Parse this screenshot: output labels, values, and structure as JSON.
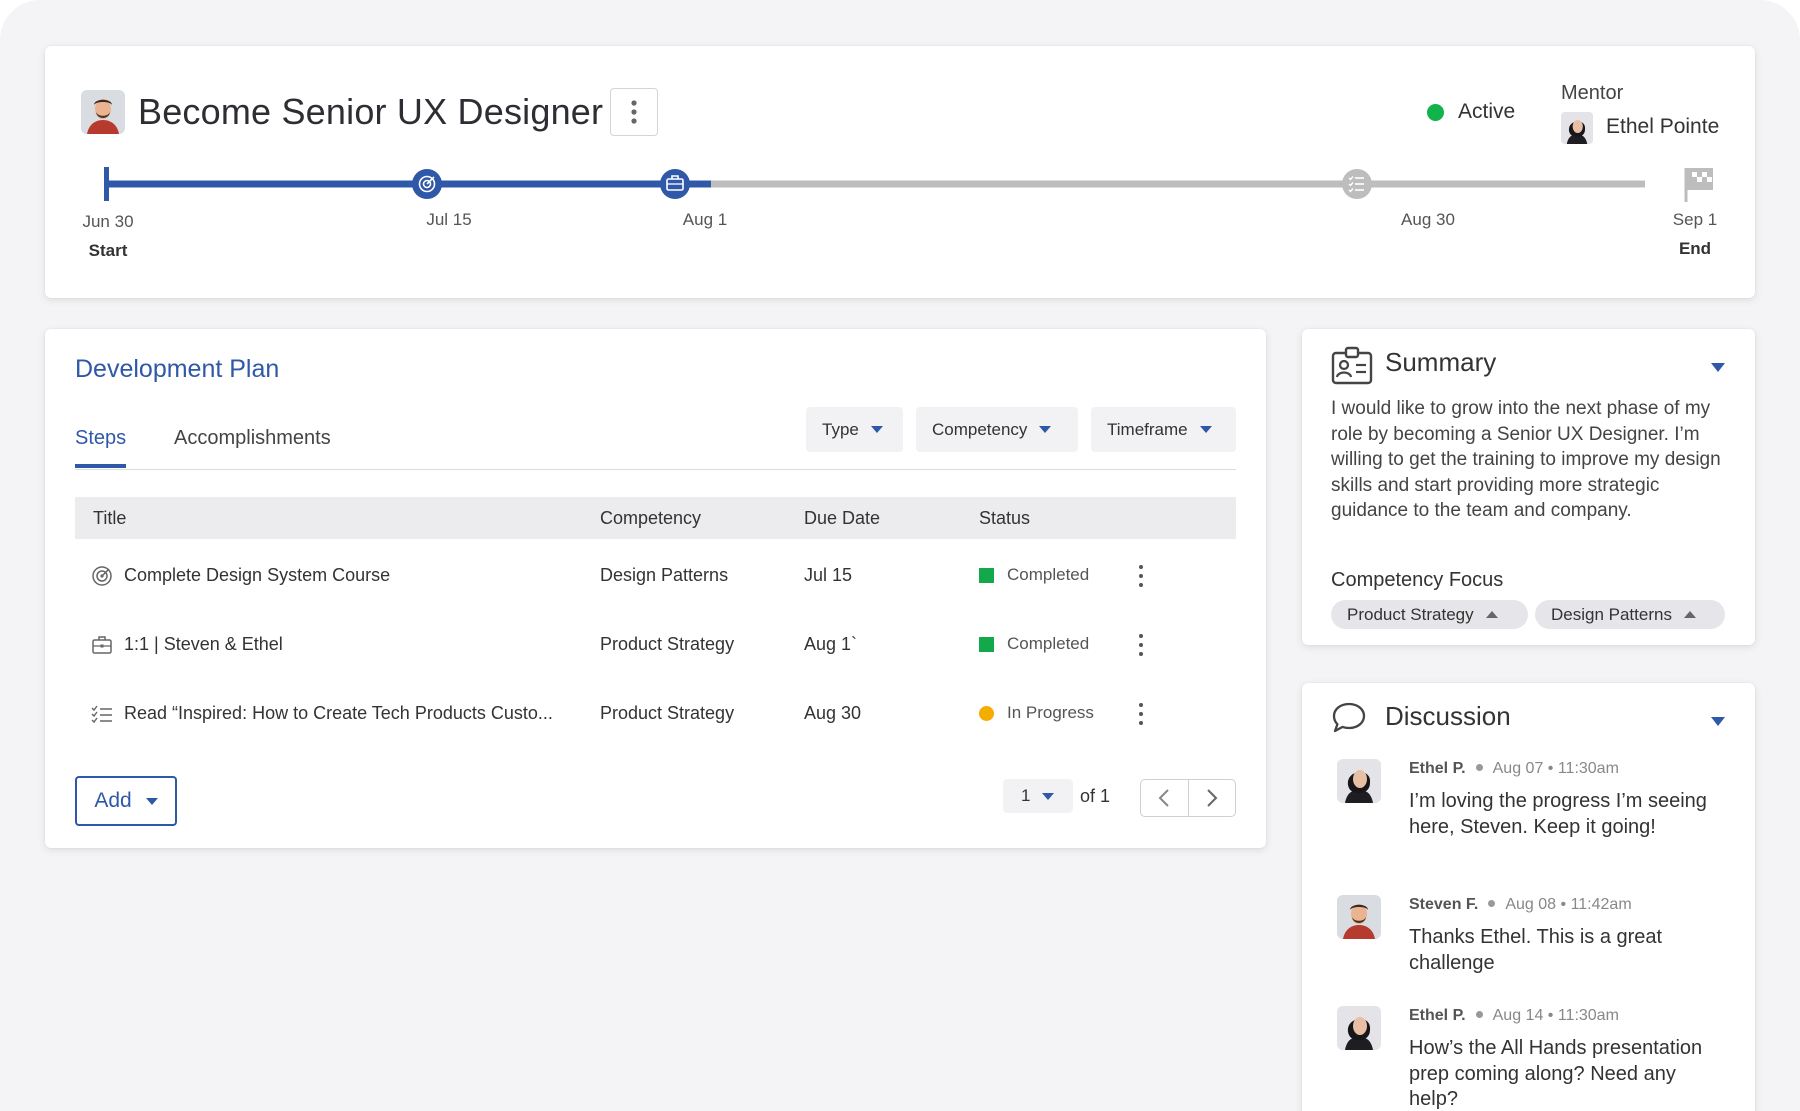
{
  "goal": {
    "title": "Become Senior UX Designer",
    "status": "Active",
    "status_color": "#12b34a",
    "mentor_label": "Mentor",
    "mentor_name": "Ethel Pointe"
  },
  "timeline": {
    "progress_color": "#2f58a8",
    "remaining_color": "#bdbdbd",
    "points": [
      {
        "date": "Jun 30",
        "sub": "Start",
        "icon": "start-marker"
      },
      {
        "date": "Jul 15",
        "sub": "",
        "icon": "target-icon"
      },
      {
        "date": "Aug 1",
        "sub": "",
        "icon": "briefcase-icon"
      },
      {
        "date": "Aug 30",
        "sub": "",
        "icon": "checklist-icon"
      },
      {
        "date": "Sep 1",
        "sub": "End",
        "icon": "flag-icon"
      }
    ]
  },
  "plan": {
    "title": "Development Plan",
    "tabs": [
      "Steps",
      "Accomplishments"
    ],
    "filters": [
      "Type",
      "Competency",
      "Timeframe"
    ],
    "columns": [
      "Title",
      "Competency",
      "Due Date",
      "Status"
    ],
    "rows": [
      {
        "icon": "target-icon",
        "title": "Complete Design System Course",
        "competency": "Design Patterns",
        "due": "Jul 15",
        "status": "Completed",
        "status_color": "#13a84a"
      },
      {
        "icon": "briefcase-icon",
        "title": "1:1 | Steven & Ethel",
        "competency": "Product Strategy",
        "due": "Aug 1`",
        "status": "Completed",
        "status_color": "#13a84a"
      },
      {
        "icon": "checklist-icon",
        "title": "Read “Inspired: How to Create Tech Products Custo...",
        "competency": "Product Strategy",
        "due": "Aug 30",
        "status": "In Progress",
        "status_color": "#f5ad00"
      }
    ],
    "add_label": "Add",
    "page_value": "1",
    "page_of": "of 1"
  },
  "summary": {
    "title": "Summary",
    "text": "I would like to grow into the next phase of my role by becoming a Senior UX Designer. I’m willing to get the training to improve my design skills and start providing more strategic guidance to the team and company.",
    "competency_label": "Competency Focus",
    "chips": [
      "Product Strategy",
      "Design Patterns"
    ]
  },
  "discussion": {
    "title": "Discussion",
    "messages": [
      {
        "author": "Ethel P.",
        "time": "Aug 07 • 11:30am",
        "body": "I’m loving the progress I’m seeing here, Steven. Keep it going!"
      },
      {
        "author": "Steven F.",
        "time": "Aug 08 • 11:42am",
        "body": "Thanks Ethel. This is a great challenge"
      },
      {
        "author": "Ethel P.",
        "time": "Aug 14 • 11:30am",
        "body": "How’s the All Hands presentation prep coming along? Need any help?"
      }
    ]
  }
}
